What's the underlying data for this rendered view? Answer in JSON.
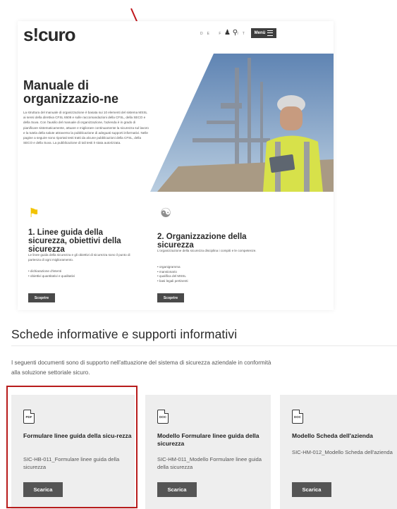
{
  "site": {
    "logo": "s!curo",
    "languages": "DE FR IT",
    "menu_label": "Menü",
    "hero_title": "Manuale di organizzazio-ne",
    "hero_text": "La struttura del manuale di organizzazione è basata sui 10 elementi del sistema MSSL ai sensi della direttiva CFSL 6508 e sulle raccomandazioni della CFSL, della SECO e della Suva. Con l'ausilio del manuale di organizzazione, l'azienda è in grado di pianificare sistematicamente, attuare e migliorare continuamente la sicurezza sul lavoro e la tutela della salute attraverso la pubblicazione di adeguati supporti informativi. Nelle pagine a seguire sono riportati testi tratti da alcune pubblicazioni della CFSL, della SECO e della Suva. La pubblicazione di tali testi è stata autorizzata.",
    "sections": [
      {
        "title": "1. Linee guida della sicurezza, obiettivi della sicurezza",
        "text": "Le linee guida della sicurezza e gli obiettivi di sicurezza sono il punto di partenza di ogni miglioramento.",
        "items": [
          "• dichiarazione d'intenti",
          "• obiettivi quantitativi e qualitativi"
        ],
        "button": "Scoprire"
      },
      {
        "title": "2. Organizzazione della sicurezza",
        "text": "L'organizzazione della sicurezza disciplina i compiti e le competenze.",
        "items": [
          "• organigramma",
          "• mansionario",
          "• qualifica del MSSL",
          "• basi legali pertinenti"
        ],
        "button": "Scoprire"
      }
    ]
  },
  "schede": {
    "title": "Schede informative e supporti informativi",
    "text": "I seguenti documenti sono di supporto nell'attuazione del sistema di sicurezza aziendale in conformità alla soluzione settoriale sicuro.",
    "cards": [
      {
        "icon": "PDF",
        "title": "Formulare linee guida della sicu-rezza",
        "file": "SIC-HB-011_Formulare linee guida della sicurezza",
        "button": "Scarica"
      },
      {
        "icon": "DOC",
        "title": "Modello Formulare linee guida della sicurezza",
        "file": "SIC-HM-011_Modello Formulare linee guida della sicurezza",
        "button": "Scarica"
      },
      {
        "icon": "DOC",
        "title": "Modello Scheda dell'azienda",
        "file": "SIC-HM-012_Modello Scheda dell'azienda",
        "button": "Scarica"
      }
    ]
  },
  "colors": {
    "accent": "#f2c300",
    "highlight": "#b81c1c",
    "card_bg": "#eeeeee",
    "button": "#555555"
  }
}
